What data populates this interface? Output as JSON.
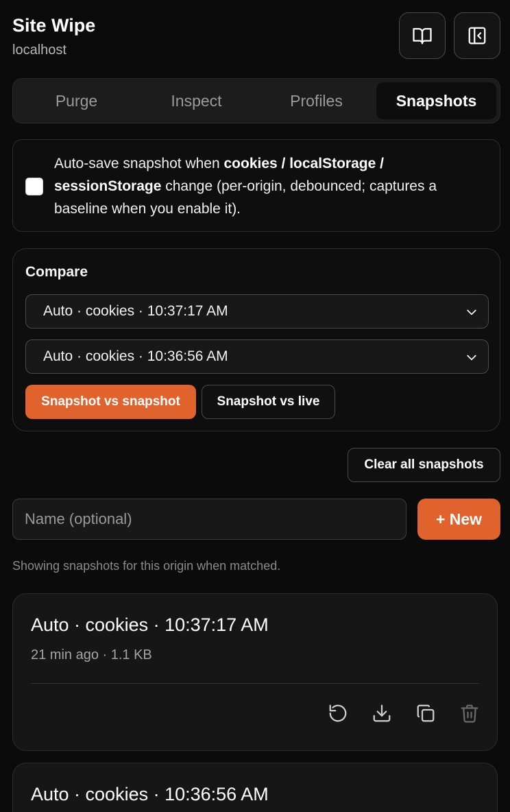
{
  "header": {
    "title": "Site Wipe",
    "host": "localhost"
  },
  "tabs": [
    {
      "label": "Purge",
      "active": false
    },
    {
      "label": "Inspect",
      "active": false
    },
    {
      "label": "Profiles",
      "active": false
    },
    {
      "label": "Snapshots",
      "active": true
    }
  ],
  "autosave": {
    "checked": false,
    "text_pre": "Auto-save snapshot when ",
    "text_bold": "cookies / localStorage / sessionStorage",
    "text_post": " change (per-origin, debounced; captures a baseline when you enable it)."
  },
  "compare": {
    "label": "Compare",
    "select_a": "Auto · cookies · 10:37:17 AM",
    "select_b": "Auto · cookies · 10:36:56 AM",
    "btn_snapshot_vs_snapshot": "Snapshot vs snapshot",
    "btn_snapshot_vs_live": "Snapshot vs live"
  },
  "actions": {
    "clear_all": "Clear all snapshots",
    "name_placeholder": "Name (optional)",
    "new_label": "+ New",
    "hint": "Showing snapshots for this origin when matched."
  },
  "snapshots": [
    {
      "title": "Auto · cookies · 10:37:17 AM",
      "meta": "21 min ago · 1.1 KB"
    },
    {
      "title": "Auto · cookies · 10:36:56 AM",
      "meta": ""
    }
  ],
  "icons": {
    "docs": "book-open-icon",
    "panel": "sidebar-collapse-icon",
    "restore": "restore-icon",
    "download": "download-icon",
    "duplicate": "copy-icon",
    "delete": "trash-icon",
    "dropdown": "chevron-down-icon"
  },
  "colors": {
    "accent": "#e0622c",
    "background": "#0b0b0b",
    "card": "#161616"
  }
}
